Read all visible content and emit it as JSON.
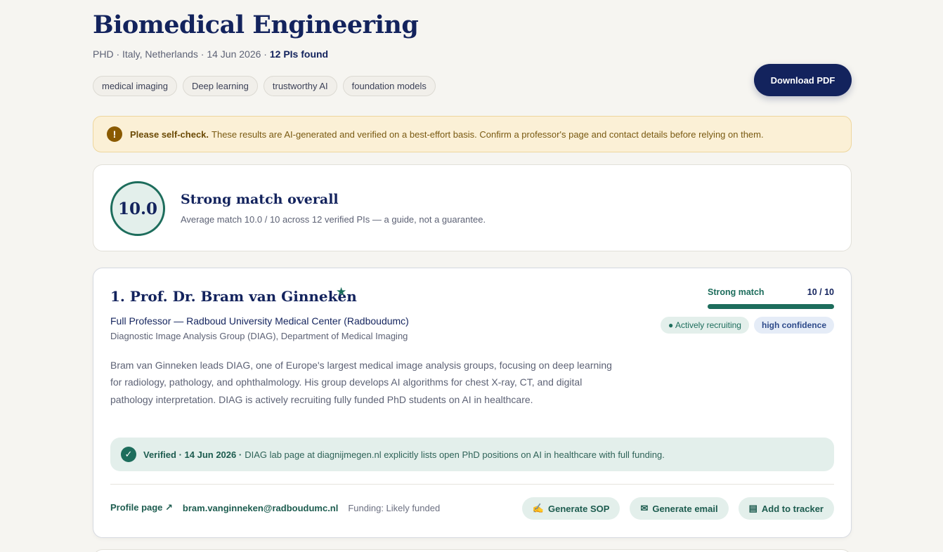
{
  "header": {
    "title": "Biomedical Engineering",
    "meta_prefix": "PHD · Italy, Netherlands · 14 Jun 2026 · ",
    "found": "12 PIs found",
    "download_label": "Download PDF"
  },
  "keywords": [
    "medical imaging",
    "Deep learning",
    "trustworthy AI",
    "foundation models"
  ],
  "notice": {
    "strong": "Please self-check.",
    "text": "These results are AI-generated and verified on a best-effort basis. Confirm a professor's page and contact details before relying on them."
  },
  "summary": {
    "score": "10.0",
    "title": "Strong match overall",
    "subtitle": "Average match 10.0 / 10 across 12 verified PIs — a guide, not a guarantee."
  },
  "pi": {
    "name": "1. Prof. Dr. Bram van Ginneken",
    "star": "★",
    "role": "Full Professor — Radboud University Medical Center (Radboudumc)",
    "group": "Diagnostic Image Analysis Group (DIAG), Department of Medical Imaging",
    "bio": "Bram van Ginneken leads DIAG, one of Europe's largest medical image analysis groups, focusing on deep learning for radiology, pathology, and ophthalmology. His group develops AI algorithms for chest X-ray, CT, and digital pathology interpretation. DIAG is actively recruiting fully funded PhD students on AI in healthcare.",
    "match_label": "Strong match",
    "match_score": "10 / 10",
    "match_fraction": 1.0,
    "badge_recruiting": "● Actively recruiting",
    "badge_confidence": "high confidence",
    "verified_label": "Verified · 14 Jun 2026 ·",
    "verified_text": "DIAG lab page at diagnijmegen.nl explicitly lists open PhD positions on AI in healthcare with full funding.",
    "profile_link": "Profile page ↗",
    "email": "bram.vanginneken@radboudumc.nl",
    "funding": "Funding: Likely funded",
    "actions": {
      "sop": "Generate SOP",
      "email": "Generate email",
      "tracker": "Add to tracker"
    }
  },
  "colors": {
    "navy": "#13235d",
    "green": "#1d6d5c",
    "warning_bg": "#fbf0d6"
  }
}
